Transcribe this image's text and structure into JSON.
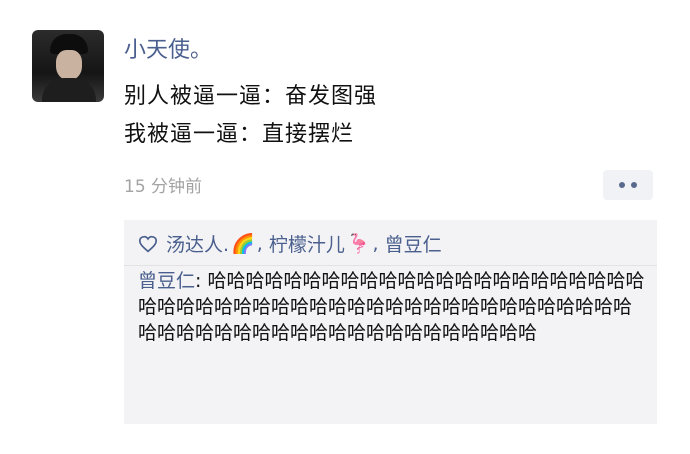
{
  "post": {
    "author": "小天使。",
    "lines": [
      "别人被逼一逼：奋发图强",
      "我被逼一逼：直接摆烂"
    ],
    "time": "15 分钟前"
  },
  "likes": {
    "icon": "heart-icon",
    "users": [
      "汤达人.",
      "柠檬汁儿",
      "曾豆仁"
    ],
    "separator": ",",
    "emoji": [
      "🌈",
      "🦩"
    ]
  },
  "comment": {
    "author": "曾豆仁",
    "colon": ": ",
    "text": "哈哈哈哈哈哈哈哈哈哈哈哈哈哈哈哈哈哈哈哈哈哈哈哈哈哈哈哈哈哈哈哈哈哈哈哈哈哈哈哈哈哈哈哈哈哈哈哈哈哈哈哈哈哈哈哈哈哈哈哈哈哈哈哈哈哈哈哈哈哈"
  },
  "colors": {
    "link": "#4a5f8e",
    "muted": "#a3a3a3",
    "panel": "#f3f3f5"
  }
}
